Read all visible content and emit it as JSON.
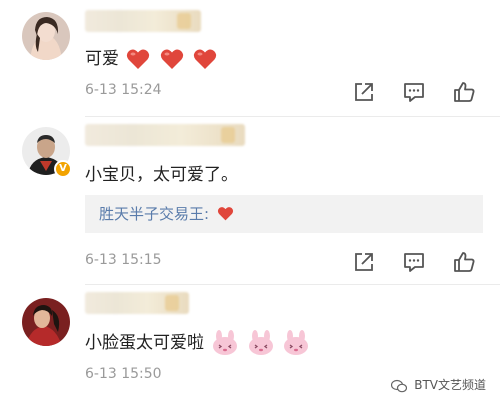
{
  "comments": [
    {
      "text": "可爱",
      "emoji_count": 3,
      "emoji": "red-heart",
      "time": "6-13 15:24"
    },
    {
      "text": "小宝贝，太可爱了。",
      "verified": "V",
      "reply_author": "胜天半子交易王:",
      "reply_emoji": "red-heart",
      "time": "6-13 15:15"
    },
    {
      "text": "小脸蛋太可爱啦",
      "emoji_count": 3,
      "emoji": "pink-bunny-face",
      "time": "6-13 15:50"
    }
  ],
  "actions": [
    "share-icon",
    "comment-icon",
    "like-icon"
  ],
  "watermark": "BTV文艺频道",
  "colors": {
    "link": "#5a7cab",
    "heart": "#e0463b",
    "verified": "#f2a300",
    "time": "#9a9a9a"
  }
}
